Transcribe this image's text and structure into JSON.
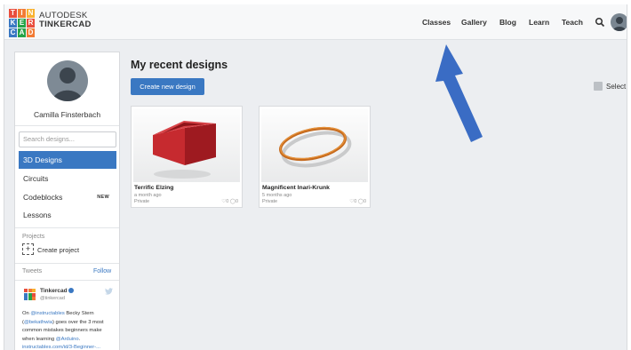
{
  "colors": {
    "brand_tiles": [
      "#e94e3d",
      "#f27b35",
      "#f9b12f",
      "#3a78c2",
      "#27a348",
      "#e94e3d",
      "#3a78c2",
      "#27a348",
      "#f27b35"
    ],
    "accent": "#3a78c2",
    "annotation_arrow": "#3a6cc4"
  },
  "logo": {
    "tiles": [
      "T",
      "I",
      "N",
      "K",
      "E",
      "R",
      "C",
      "A",
      "D"
    ],
    "line1": "AUTODESK",
    "line2": "TINKERCAD"
  },
  "nav": {
    "items": [
      "Classes",
      "Gallery",
      "Blog",
      "Learn",
      "Teach"
    ],
    "search_icon": "search-icon",
    "avatar_icon": "user-avatar-icon"
  },
  "profile": {
    "name": "Camilla Finsterbach",
    "avatar_icon": "default-user-avatar"
  },
  "sidebar": {
    "search_placeholder": "Search designs...",
    "menu": [
      {
        "label": "3D Designs",
        "active": true,
        "badge": ""
      },
      {
        "label": "Circuits",
        "badge": ""
      },
      {
        "label": "Codeblocks",
        "badge": "NEW"
      },
      {
        "label": "Lessons",
        "badge": ""
      }
    ],
    "projects_label": "Projects",
    "create_project": "Create project",
    "tweets_label": "Tweets",
    "follow": "Follow",
    "tweet": {
      "name": "Tinkercad",
      "handle": "@tinkercad",
      "pre": "On ",
      "link1": "@instructables",
      "mid1": " Becky Stern (",
      "link2": "@bekathwia",
      "mid2": ") goes over the 3 most common mistakes beginners make when learning ",
      "link3": "@Arduino",
      "mid3": ". ",
      "link4": "instructables.com/id/3-Beginner-..."
    }
  },
  "main": {
    "title": "My recent designs",
    "create_button": "Create new design",
    "select_label": "Select",
    "designs": [
      {
        "title": "Terrific Elzing",
        "time": "a month ago",
        "privacy": "Private",
        "stats": "♡0 ◯0",
        "thumb": "red-box-model"
      },
      {
        "title": "Magnificent Inari-Krunk",
        "time": "5 months ago",
        "privacy": "Private",
        "stats": "♡0 ◯0",
        "thumb": "orange-ring-model"
      }
    ]
  }
}
